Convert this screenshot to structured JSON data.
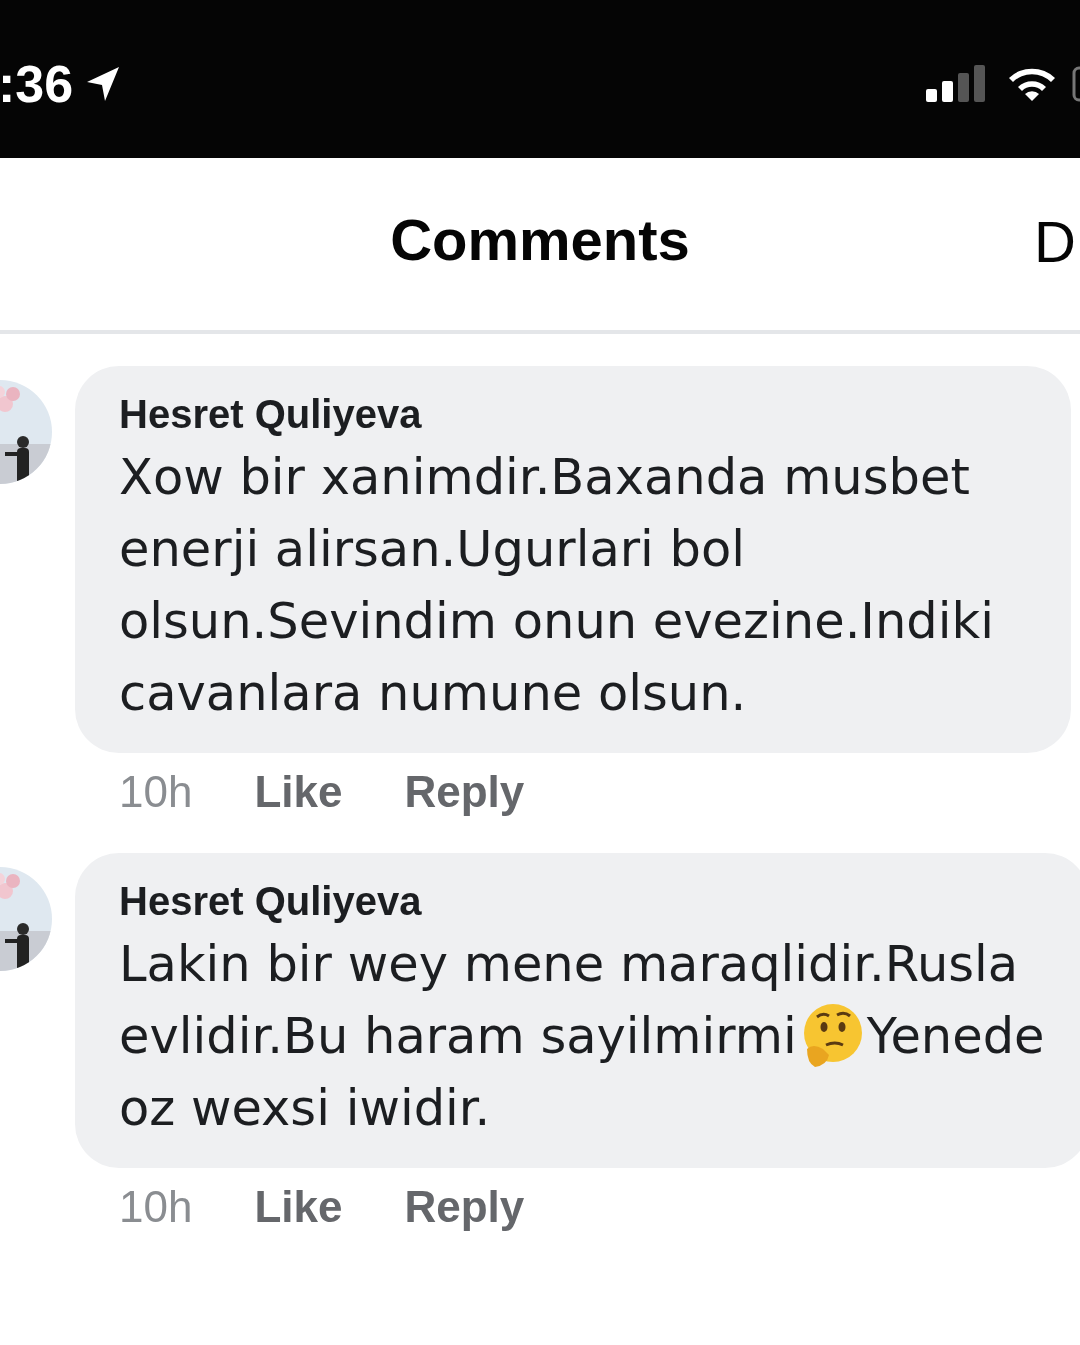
{
  "status_bar": {
    "time": ":36"
  },
  "header": {
    "title": "Comments",
    "side_label": "D"
  },
  "comments": [
    {
      "author": "Hesret Quliyeva",
      "lines": [
        [
          {
            "kind": "text",
            "text": "Xow bir xanimdir.Baxanda musbet"
          }
        ],
        [
          {
            "kind": "text",
            "text": "enerji alirsan.Ugurlari bol"
          }
        ],
        [
          {
            "kind": "text",
            "text": "olsun.Sevindim onun evezine.Indiki"
          }
        ],
        [
          {
            "kind": "text",
            "text": "cavanlara numune olsun."
          }
        ]
      ],
      "time": "10h",
      "like": "Like",
      "reply": "Reply"
    },
    {
      "author": "Hesret Quliyeva",
      "lines": [
        [
          {
            "kind": "text",
            "text": "Lakin bir wey mene maraqlidir.Rusla"
          }
        ],
        [
          {
            "kind": "text",
            "text": "evlidir.Bu haram sayilmirmi"
          },
          {
            "kind": "emoji"
          },
          {
            "kind": "text",
            "text": "Yenede"
          }
        ],
        [
          {
            "kind": "text",
            "text": "oz wexsi iwidir."
          }
        ]
      ],
      "time": "10h",
      "like": "Like",
      "reply": "Reply"
    }
  ]
}
